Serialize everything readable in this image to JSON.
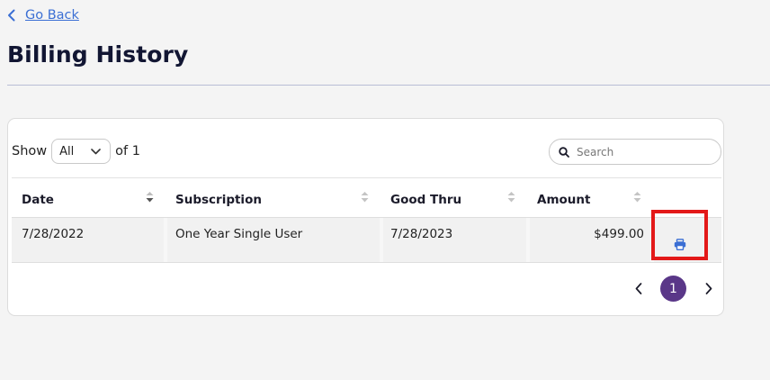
{
  "nav": {
    "back_label": "Go Back"
  },
  "page": {
    "title": "Billing History"
  },
  "table_controls": {
    "show_label": "Show",
    "page_size_value": "All",
    "of_label": "of 1",
    "search_placeholder": "Search"
  },
  "table": {
    "columns": [
      "Date",
      "Subscription",
      "Good Thru",
      "Amount"
    ],
    "rows": [
      {
        "date": "7/28/2022",
        "subscription": "One Year Single User",
        "good_thru": "7/28/2023",
        "amount": "$499.00"
      }
    ]
  },
  "pagination": {
    "current_page": "1"
  },
  "colors": {
    "link": "#3b6fd4",
    "print_icon": "#3b6fd4",
    "active_page": "#5a3788",
    "highlight": "#e31919"
  },
  "icons": [
    "chevron-left-icon",
    "chevron-down-icon",
    "search-icon",
    "sort-icon",
    "printer-icon",
    "chevron-right-icon"
  ]
}
